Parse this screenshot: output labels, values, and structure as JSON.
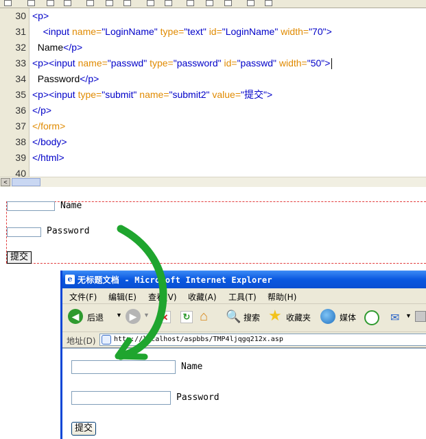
{
  "editor": {
    "lines": [
      {
        "num": "30",
        "indent": "",
        "parts": [
          [
            "tag",
            "<p>"
          ]
        ]
      },
      {
        "num": "31",
        "indent": "    ",
        "parts": [
          [
            "tag",
            "<input "
          ],
          [
            "attr",
            "name="
          ],
          [
            "val",
            "\"LoginName\" "
          ],
          [
            "attr",
            "type="
          ],
          [
            "val",
            "\"text\" "
          ],
          [
            "attr",
            "id="
          ],
          [
            "val",
            "\"LoginName\" "
          ],
          [
            "attr",
            "width="
          ],
          [
            "val",
            "\"70\""
          ],
          [
            "tag",
            ">"
          ]
        ]
      },
      {
        "num": "32",
        "indent": "  ",
        "parts": [
          [
            "txt",
            "Name"
          ],
          [
            "tag",
            "</p>"
          ]
        ]
      },
      {
        "num": "33",
        "indent": "",
        "parts": [
          [
            "tag",
            "<p>"
          ],
          [
            "tag",
            "<input "
          ],
          [
            "attr",
            "name="
          ],
          [
            "val",
            "\"passwd\" "
          ],
          [
            "attr",
            "type="
          ],
          [
            "val",
            "\"password\" "
          ],
          [
            "attr",
            "id="
          ],
          [
            "val",
            "\"passwd\" "
          ],
          [
            "attr",
            "width="
          ],
          [
            "val",
            "\"50\""
          ],
          [
            "tag",
            ">"
          ]
        ]
      },
      {
        "num": "34",
        "indent": "  ",
        "parts": [
          [
            "txt",
            "Password"
          ],
          [
            "tag",
            "</p>"
          ]
        ]
      },
      {
        "num": "35",
        "indent": "",
        "parts": [
          [
            "tag",
            "<p>"
          ],
          [
            "tag",
            "<input "
          ],
          [
            "attr",
            "type="
          ],
          [
            "val",
            "\"submit\" "
          ],
          [
            "attr",
            "name="
          ],
          [
            "val",
            "\"submit2\" "
          ],
          [
            "attr",
            "value="
          ],
          [
            "val",
            "\"提交\""
          ],
          [
            "tag",
            ">"
          ]
        ]
      },
      {
        "num": "36",
        "indent": "",
        "parts": [
          [
            "tag",
            "</p>"
          ]
        ]
      },
      {
        "num": "37",
        "indent": "",
        "parts": [
          [
            "attr",
            "</form>"
          ]
        ]
      },
      {
        "num": "38",
        "indent": "",
        "parts": [
          [
            "tag",
            "</body>"
          ]
        ]
      },
      {
        "num": "39",
        "indent": "",
        "parts": [
          [
            "tag",
            "</html>"
          ]
        ]
      },
      {
        "num": "40",
        "indent": "",
        "parts": []
      }
    ],
    "colors": {
      "tag": "#0000c8",
      "attr": "#e08a00",
      "val": "#0000c8",
      "text": "#000000"
    }
  },
  "scrollbar": {
    "left_arrow": "<"
  },
  "design_view": {
    "name_label": "Name",
    "password_label": "Password",
    "submit_label": "提交",
    "border_color": "#e23a3a"
  },
  "browser": {
    "title": "无标题文档 - Microsoft Internet Explorer",
    "menu": [
      "文件(F)",
      "编辑(E)",
      "查看(V)",
      "收藏(A)",
      "工具(T)",
      "帮助(H)"
    ],
    "toolbar": {
      "back": "后退",
      "search": "搜索",
      "favorites": "收藏夹",
      "media": "媒体"
    },
    "address_label": "地址(D)",
    "url": "http://localhost/aspbbs/TMP4ljqgq212x.asp",
    "page": {
      "name_label": "Name",
      "password_label": "Password",
      "submit_label": "提交"
    },
    "title_bar_color": "#0a58e0"
  },
  "annotation": {
    "arrow_color": "#1fa52e"
  }
}
